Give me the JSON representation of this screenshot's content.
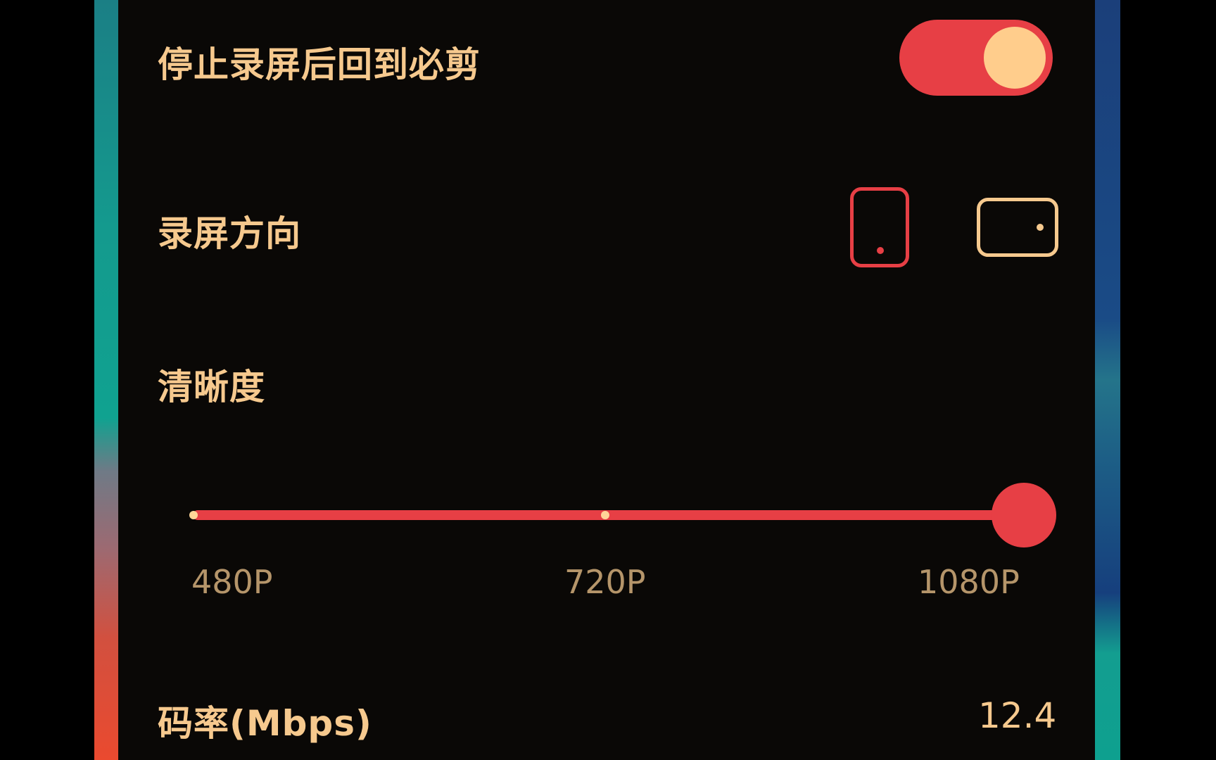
{
  "settings": {
    "stop_return": {
      "label": "停止录屏后回到必剪",
      "enabled": true
    },
    "orientation": {
      "label": "录屏方向",
      "options": [
        "portrait-icon",
        "landscape-icon"
      ],
      "selected": "portrait"
    },
    "quality": {
      "label": "清晰度",
      "options": [
        "480P",
        "720P",
        "1080P"
      ],
      "selected": "1080P"
    },
    "bitrate": {
      "label": "码率(Mbps)",
      "value": "12.4"
    }
  },
  "colors": {
    "background": "#0a0806",
    "accent_red": "#e73f45",
    "text_gold": "#f6c98e",
    "tick_label": "#b5956a",
    "knob": "#ffcd8c"
  }
}
